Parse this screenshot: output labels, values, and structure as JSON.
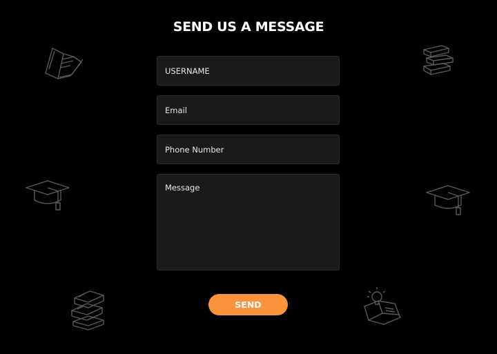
{
  "form": {
    "title": "SEND US A MESSAGE",
    "username_placeholder": "USERNAME",
    "email_placeholder": "Email",
    "phone_placeholder": "Phone Number",
    "message_placeholder": "Message",
    "send_label": "SEND"
  },
  "colors": {
    "background": "#000000",
    "field_background": "#1a1a1a",
    "accent": "#fb923c",
    "icon_stroke": "#6b6b6b"
  },
  "decorations": [
    "open-book-icon",
    "stacked-books-icon",
    "graduation-cap-icon",
    "graduation-cap-icon",
    "stacked-books-icon",
    "lightbulb-book-icon"
  ]
}
